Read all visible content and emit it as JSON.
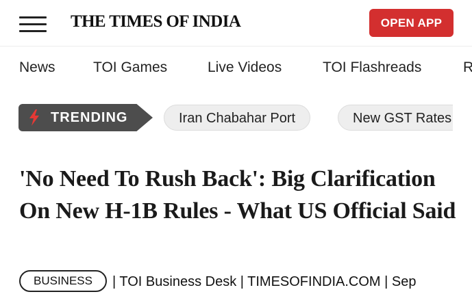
{
  "header": {
    "logo": "THE TIMES OF INDIA",
    "open_app_label": "OPEN APP",
    "accent_color": "#d32f2f"
  },
  "nav": {
    "items": [
      {
        "label": "News"
      },
      {
        "label": "TOI Games"
      },
      {
        "label": "Live Videos"
      },
      {
        "label": "TOI Flashreads"
      },
      {
        "label": "R"
      }
    ]
  },
  "trending": {
    "label": "TRENDING",
    "icon": "lightning-bolt-icon",
    "pills": [
      {
        "label": "Iran Chabahar Port"
      },
      {
        "label": "New GST Rates"
      }
    ]
  },
  "article": {
    "headline": "'No Need To Rush Back': Big Clarification On New H-1B Rules - What US Official Said",
    "category": "BUSINESS",
    "byline": "| TOI Business Desk | TIMESOFINDIA.COM | Sep"
  }
}
